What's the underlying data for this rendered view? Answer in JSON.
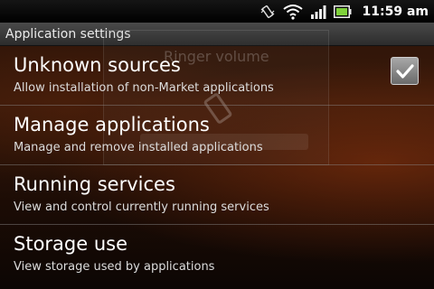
{
  "statusbar": {
    "time": "11:59 am",
    "icons": [
      "vibrate-icon",
      "wifi-icon",
      "signal-icon",
      "battery-icon"
    ]
  },
  "titlebar": {
    "title": "Application settings"
  },
  "ghost_dialog": {
    "title": "Ringer volume"
  },
  "settings": [
    {
      "title": "Unknown sources",
      "subtitle": "Allow installation of non-Market applications",
      "checked": true
    },
    {
      "title": "Manage applications",
      "subtitle": "Manage and remove installed applications"
    },
    {
      "title": "Running services",
      "subtitle": "View and control currently running services"
    },
    {
      "title": "Storage use",
      "subtitle": "View storage used by applications"
    }
  ],
  "colors": {
    "accent": "#3a1a0a",
    "status_bar": "#000000",
    "battery_fill": "#7fd13b"
  }
}
